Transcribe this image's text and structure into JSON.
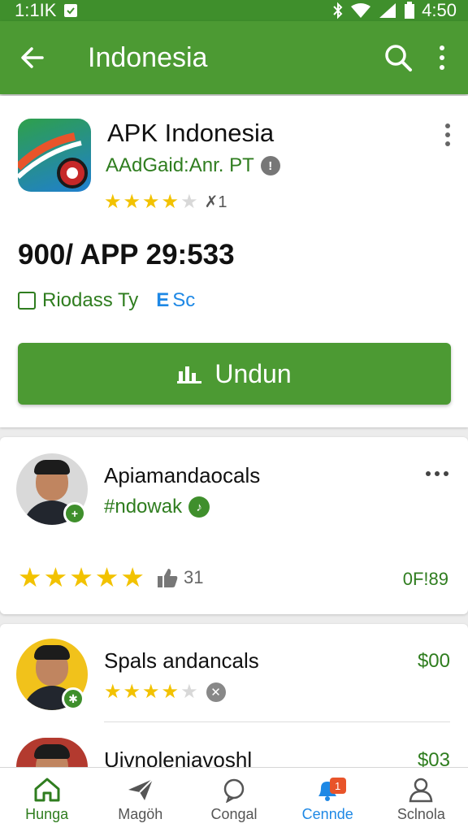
{
  "status_bar": {
    "left_text": "1:1IK",
    "time": "4:50"
  },
  "app_bar": {
    "title": "Indonesia",
    "back_icon": "arrow-left-icon",
    "search_icon": "search-icon",
    "more_icon": "more-vert-icon"
  },
  "app": {
    "name": "APK Indonesia",
    "developer": "AAdGaid:Anr. PT",
    "rating_stars": 3.5,
    "rating_count": "1",
    "stat_line": "900/ APP 29:533",
    "tag_one": "Riodass Ty",
    "tag_two_mark": "E",
    "tag_two": "Sc",
    "download_label": "Undun"
  },
  "reviews": [
    {
      "name": "Apiamandaocals",
      "subtitle": "#ndowak",
      "stars": 5,
      "likes": "31",
      "code": "0F!89"
    },
    {
      "name": "Spals andancals",
      "price": "$00",
      "stars": 4
    },
    {
      "name": "Uivnolenjavoshl",
      "price": "$03"
    }
  ],
  "bottom_nav": [
    {
      "label": "Hunga",
      "icon": "home-icon"
    },
    {
      "label": "Magöh",
      "icon": "paper-plane-icon"
    },
    {
      "label": "Congal",
      "icon": "chat-bubble-icon"
    },
    {
      "label": "Cennde",
      "icon": "notification-bell-icon",
      "badge": "1"
    },
    {
      "label": "Sclnola",
      "icon": "person-icon"
    }
  ],
  "colors": {
    "primary_green": "#4c9a33",
    "status_green": "#3f8f2c",
    "text_green": "#2f7d1f",
    "star_yellow": "#f2c200",
    "accent_blue": "#1e88e5"
  }
}
